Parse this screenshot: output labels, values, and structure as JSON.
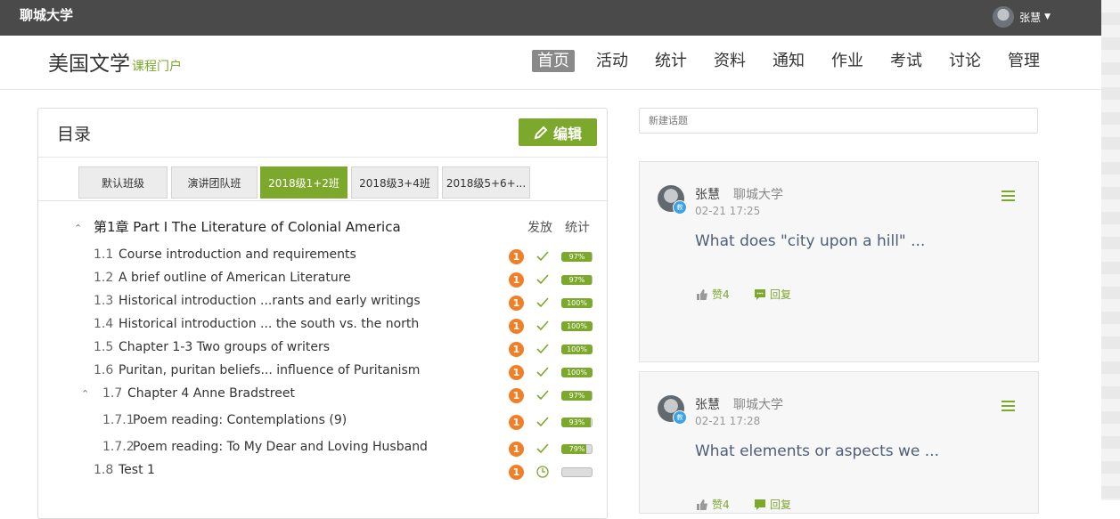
{
  "topbar": {
    "school": "聊城大学",
    "user_name": "张慧"
  },
  "header": {
    "course_title": "美国文学",
    "course_sub": "课程门户",
    "nav": [
      {
        "label": "首页"
      },
      {
        "label": "活动"
      },
      {
        "label": "统计"
      },
      {
        "label": "资料"
      },
      {
        "label": "通知"
      },
      {
        "label": "作业"
      },
      {
        "label": "考试"
      },
      {
        "label": "讨论"
      },
      {
        "label": "管理"
      }
    ]
  },
  "catalog": {
    "title": "目录",
    "edit_label": "编辑",
    "tabs": [
      {
        "label": "默认班级"
      },
      {
        "label": "演讲团队班"
      },
      {
        "label": "2018级1+2班"
      },
      {
        "label": "2018级3+4班"
      },
      {
        "label": "2018级5+6+..."
      }
    ],
    "active_tab": "2018级1+2班",
    "chapter_title": "第1章 Part I The Literature of Colonial America",
    "col_release": "发放",
    "col_stats": "统计",
    "sections": [
      {
        "num": "1.1",
        "title": "Course introduction and requirements",
        "badge": "1",
        "status": "check",
        "progress": 97,
        "progress_label": "97%"
      },
      {
        "num": "1.2",
        "title": "A brief outline of American Literature",
        "badge": "1",
        "status": "check",
        "progress": 97,
        "progress_label": "97%"
      },
      {
        "num": "1.3",
        "title": "Historical introduction ...rants and early writings",
        "badge": "1",
        "status": "check",
        "progress": 100,
        "progress_label": "100%"
      },
      {
        "num": "1.4",
        "title": "Historical introduction ... the south vs. the north",
        "badge": "1",
        "status": "check",
        "progress": 100,
        "progress_label": "100%"
      },
      {
        "num": "1.5",
        "title": "Chapter 1-3 Two groups of writers",
        "badge": "1",
        "status": "check",
        "progress": 100,
        "progress_label": "100%"
      },
      {
        "num": "1.6",
        "title": "Puritan, puritan beliefs... influence of Puritanism",
        "badge": "1",
        "status": "check",
        "progress": 100,
        "progress_label": "100%"
      },
      {
        "num": "1.7",
        "title": "Chapter 4 Anne Bradstreet",
        "badge": "1",
        "status": "check",
        "progress": 97,
        "progress_label": "97%"
      },
      {
        "num": "1.7.1",
        "title": "Poem reading: Contemplations (9)",
        "badge": "1",
        "status": "check",
        "progress": 93,
        "progress_label": "93%"
      },
      {
        "num": "1.7.2",
        "title": "Poem reading: To My Dear and Loving Husband",
        "badge": "1",
        "status": "check",
        "progress": 79,
        "progress_label": "79%"
      },
      {
        "num": "1.8",
        "title": "Test 1",
        "badge": "1",
        "status": "clock",
        "progress": 0,
        "progress_label": ""
      }
    ]
  },
  "discussion": {
    "new_topic_placeholder": "新建话题",
    "posts": [
      {
        "author": "张慧",
        "school": "聊城大学",
        "time": "02-21 17:25",
        "text": "What does \"city upon a hill\" ...",
        "likes": "赞4",
        "reply": "回复",
        "role_badge": "教"
      },
      {
        "author": "张慧",
        "school": "聊城大学",
        "time": "02-21 17:28",
        "text": "What elements or aspects we ...",
        "likes": "赞4",
        "reply": "回复",
        "role_badge": "教"
      }
    ]
  },
  "colors": {
    "accent": "#7ca82b",
    "topbar": "#4a4a4a",
    "badge": "#f08028"
  }
}
